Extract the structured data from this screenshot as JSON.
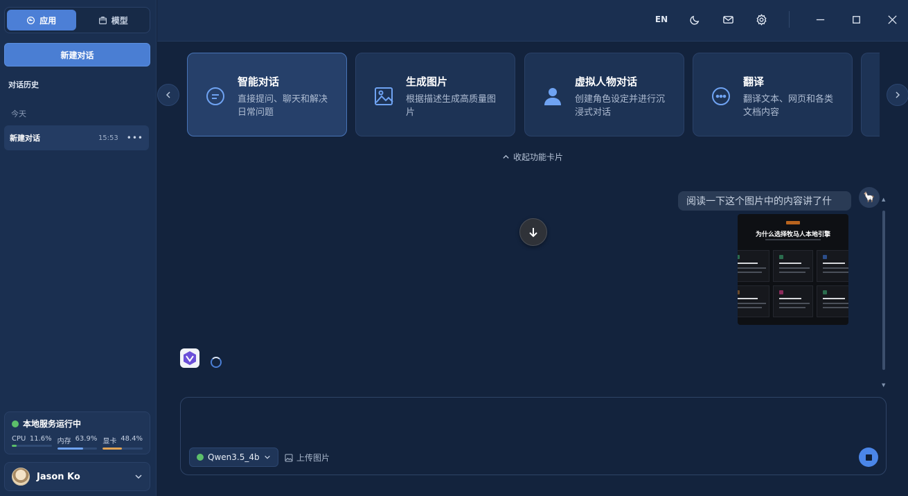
{
  "sidebar": {
    "tabs": [
      {
        "label": "应用",
        "icon": "chat-bubble-icon",
        "active": true
      },
      {
        "label": "模型",
        "icon": "box-icon",
        "active": false
      }
    ],
    "new_chat_label": "新建对话",
    "history_title": "对话历史",
    "group_today": "今天",
    "history_items": [
      {
        "title": "新建对话",
        "time": "15:53"
      }
    ],
    "service": {
      "status_label": "本地服务运行中",
      "status_color": "#5cbf6a",
      "stats": [
        {
          "label": "CPU",
          "value": "11.6%",
          "fraction": 0.116,
          "color": "#5cbf6a"
        },
        {
          "label": "内存",
          "value": "63.9%",
          "fraction": 0.639,
          "color": "#6fa3f2"
        },
        {
          "label": "显卡",
          "value": "48.4%",
          "fraction": 0.484,
          "color": "#e0a253"
        }
      ]
    },
    "user_name": "Jason Ko"
  },
  "topbar": {
    "lang_label": "EN",
    "icons": [
      "moon-icon",
      "mail-icon",
      "gear-icon",
      "minimize-icon",
      "maximize-icon",
      "close-icon"
    ]
  },
  "cards": [
    {
      "title": "智能对话",
      "desc": "直接提问、聊天和解决日常问题",
      "icon": "chat-bubble-icon",
      "active": true
    },
    {
      "title": "生成图片",
      "desc": "根据描述生成高质量图片",
      "icon": "image-icon",
      "active": false
    },
    {
      "title": "虚拟人物对话",
      "desc": "创建角色设定并进行沉浸式对话",
      "icon": "person-icon",
      "active": false
    },
    {
      "title": "翻译",
      "desc": "翻译文本、网页和各类文档内容",
      "icon": "dots-bubble-icon",
      "active": false
    }
  ],
  "collapse_label": "收起功能卡片",
  "conversation": {
    "user_message": "阅读一下这个图片中的内容讲了什么:",
    "attachment_title": "为什么选择牧马人本地引擎"
  },
  "composer": {
    "model_name": "Qwen3.5_4b",
    "model_status_color": "#5cbf6a",
    "upload_label": "上传图片"
  },
  "colors": {
    "accent": "#4a7ed3",
    "background": "#13233d",
    "sidebar": "#1a2f50"
  }
}
